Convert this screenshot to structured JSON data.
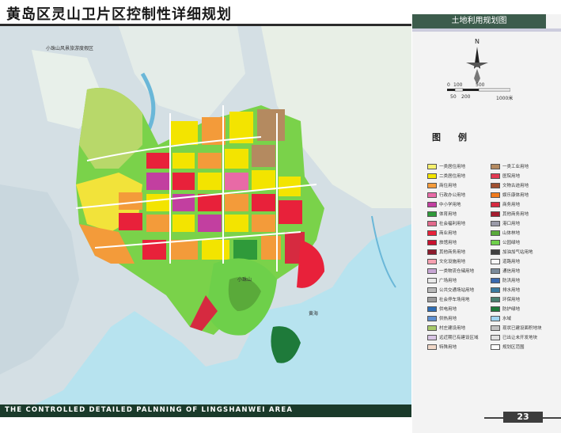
{
  "title": "黄岛区灵山卫片区控制性详细规划",
  "footer": "THE CONTROLLED DETAILED PALNNING OF LINGSHANWEI AREA",
  "panel": {
    "header": "土地利用规划图",
    "north": "N",
    "scale_top": [
      "0",
      "100",
      "500"
    ],
    "scale_bottom": [
      "50",
      "200",
      "1000米"
    ],
    "legend_title": "图例"
  },
  "page_number": "23",
  "map_labels": {
    "nw": "小珠山风景旅游度假区",
    "bay": "黄海",
    "mountain": "小珠山"
  },
  "legend": {
    "left": [
      {
        "label": "一类居住用地",
        "color": "#f5f06e"
      },
      {
        "label": "二类居住用地",
        "color": "#f3e400"
      },
      {
        "label": "商住用地",
        "color": "#f39b3a"
      },
      {
        "label": "行政办公用地",
        "color": "#e86aa6"
      },
      {
        "label": "中小学用地",
        "color": "#c23fa0"
      },
      {
        "label": "体育用地",
        "color": "#2f9a3a"
      },
      {
        "label": "社会福利用地",
        "color": "#e26a8c"
      },
      {
        "label": "商业用地",
        "color": "#e8213a"
      },
      {
        "label": "旅馆用地",
        "color": "#c8102e"
      },
      {
        "label": "其他商务用地",
        "color": "#8c1a2c"
      },
      {
        "label": "文化设施用地",
        "color": "#f6a0b0"
      },
      {
        "label": "一类物流仓储用地",
        "color": "#c7a6d4"
      },
      {
        "label": "广场用地",
        "color": "#e8e8e8"
      },
      {
        "label": "公共交通场站用地",
        "color": "#b8b8b8"
      },
      {
        "label": "社会停车场用地",
        "color": "#9a9a9a"
      },
      {
        "label": "供电用地",
        "color": "#2e6db4"
      },
      {
        "label": "供热用地",
        "color": "#5e8fd0"
      },
      {
        "label": "村庄建设用地",
        "color": "#a7c96a"
      },
      {
        "label": "远近期已有建设区域",
        "color": "#d8c4e4"
      },
      {
        "label": "特殊用地",
        "color": "#f0d8c8"
      }
    ],
    "right": [
      {
        "label": "一类工业用地",
        "color": "#b48a60"
      },
      {
        "label": "医院用地",
        "color": "#e23a52"
      },
      {
        "label": "文物古迹用地",
        "color": "#a05030"
      },
      {
        "label": "娱乐康体用地",
        "color": "#f07a1c"
      },
      {
        "label": "商务用地",
        "color": "#d62a40"
      },
      {
        "label": "其他商务用地",
        "color": "#a51c2f"
      },
      {
        "label": "港口用地",
        "color": "#9a9aa8"
      },
      {
        "label": "山体林地",
        "color": "#5aaa3a"
      },
      {
        "label": "公园绿地",
        "color": "#6ed04a"
      },
      {
        "label": "加油加气站用地",
        "color": "#404040"
      },
      {
        "label": "道路用地",
        "color": "#f8f8f8"
      },
      {
        "label": "通信用地",
        "color": "#7a8a9a"
      },
      {
        "label": "防洪用地",
        "color": "#3a6ab0"
      },
      {
        "label": "排水用地",
        "color": "#3a7aa0"
      },
      {
        "label": "环保用地",
        "color": "#4a8070"
      },
      {
        "label": "防护绿地",
        "color": "#1e7a3a"
      },
      {
        "label": "水域",
        "color": "#9fd4f0"
      },
      {
        "label": "现状已建设面积地块",
        "color": "#c0c0c0"
      },
      {
        "label": "已出让未开发地块",
        "color": "#e0e0e0"
      },
      {
        "label": "规划区范围",
        "color": "#ffffff"
      }
    ]
  }
}
